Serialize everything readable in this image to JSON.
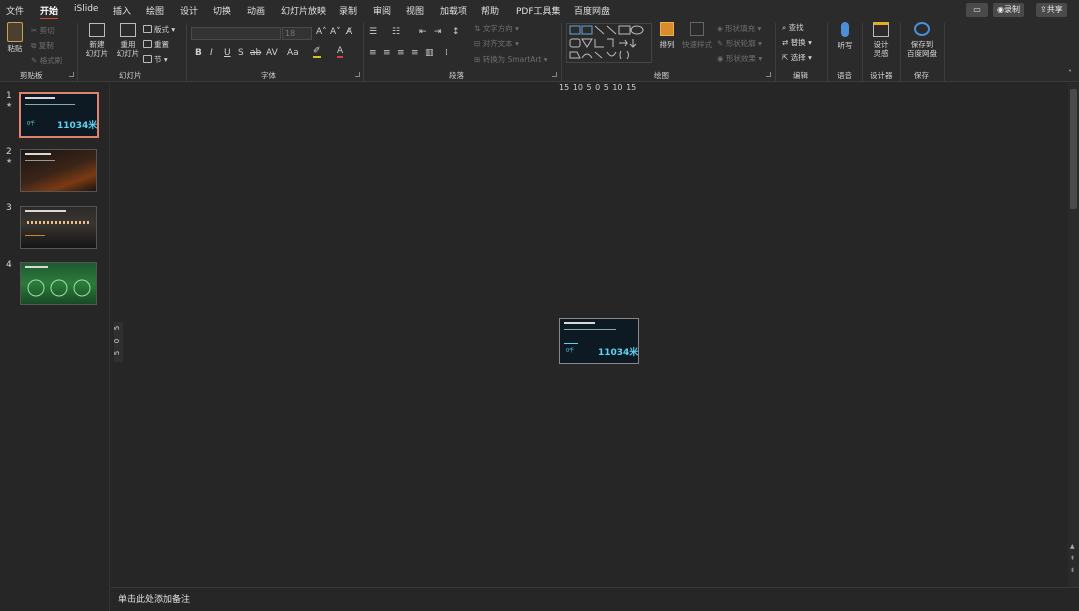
{
  "menu": {
    "tabs": [
      {
        "label": "文件"
      },
      {
        "label": "开始"
      },
      {
        "label": "iSlide"
      },
      {
        "label": "插入"
      },
      {
        "label": "绘图"
      },
      {
        "label": "设计"
      },
      {
        "label": "切换"
      },
      {
        "label": "动画"
      },
      {
        "label": "幻灯片放映"
      },
      {
        "label": "录制"
      },
      {
        "label": "审阅"
      },
      {
        "label": "视图"
      },
      {
        "label": "加载项"
      },
      {
        "label": "帮助"
      },
      {
        "label": "PDF工具集"
      },
      {
        "label": "百度网盘"
      }
    ],
    "active_tab": "开始",
    "record_label": "录制",
    "share_label": "共享"
  },
  "ribbon": {
    "clipboard": {
      "paste": "粘贴",
      "cut": "剪切",
      "copy": "复制",
      "format_painter": "格式刷",
      "label": "剪贴板"
    },
    "slides": {
      "new_slide_1": "新建",
      "new_slide_2": "幻灯片",
      "reuse_1": "重用",
      "reuse_2": "幻灯片",
      "layout": "版式",
      "reset": "重置",
      "section": "节",
      "label": "幻灯片"
    },
    "font": {
      "size": "18",
      "bold": "B",
      "italic": "I",
      "underline": "U",
      "shadow": "S",
      "strike": "ab",
      "spacing": "AV",
      "case": "Aa",
      "label": "字体"
    },
    "paragraph": {
      "text_direction": "文字方向",
      "align_text": "对齐文本",
      "smartart": "转换为 SmartArt",
      "label": "段落"
    },
    "drawing": {
      "arrange": "排列",
      "quick_styles": "快速样式",
      "shape_fill": "形状填充",
      "shape_outline": "形状轮廓",
      "shape_effects": "形状效果",
      "label": "绘图"
    },
    "editing": {
      "find": "查找",
      "replace": "替换",
      "select": "选择",
      "label": "编辑"
    },
    "voice": {
      "dictate": "听写",
      "label": "语音"
    },
    "designer": {
      "design_1": "设计",
      "design_2": "灵感",
      "label": "设计器"
    },
    "save": {
      "save_1": "保存到",
      "save_2": "百度网盘",
      "label": "保存"
    }
  },
  "thumbnails": [
    {
      "number": "1",
      "star": "★",
      "big_text": "11034米",
      "small_text": "0千"
    },
    {
      "number": "2",
      "star": "★"
    },
    {
      "number": "3"
    },
    {
      "number": "4"
    }
  ],
  "ruler": {
    "horizontal": "15 10 5  0  5 10 15",
    "vertical_0": "5",
    "vertical_1": "0",
    "vertical_2": "5"
  },
  "slide": {
    "big_text": "11034米",
    "small_text": "0千"
  },
  "notes": {
    "placeholder": "单击此处添加备注"
  },
  "colors": {
    "accent": "#d24726",
    "selected_thumb": "#e0826c",
    "slide_bg": "#0d1a24",
    "cyan": "#5fd3f0"
  }
}
